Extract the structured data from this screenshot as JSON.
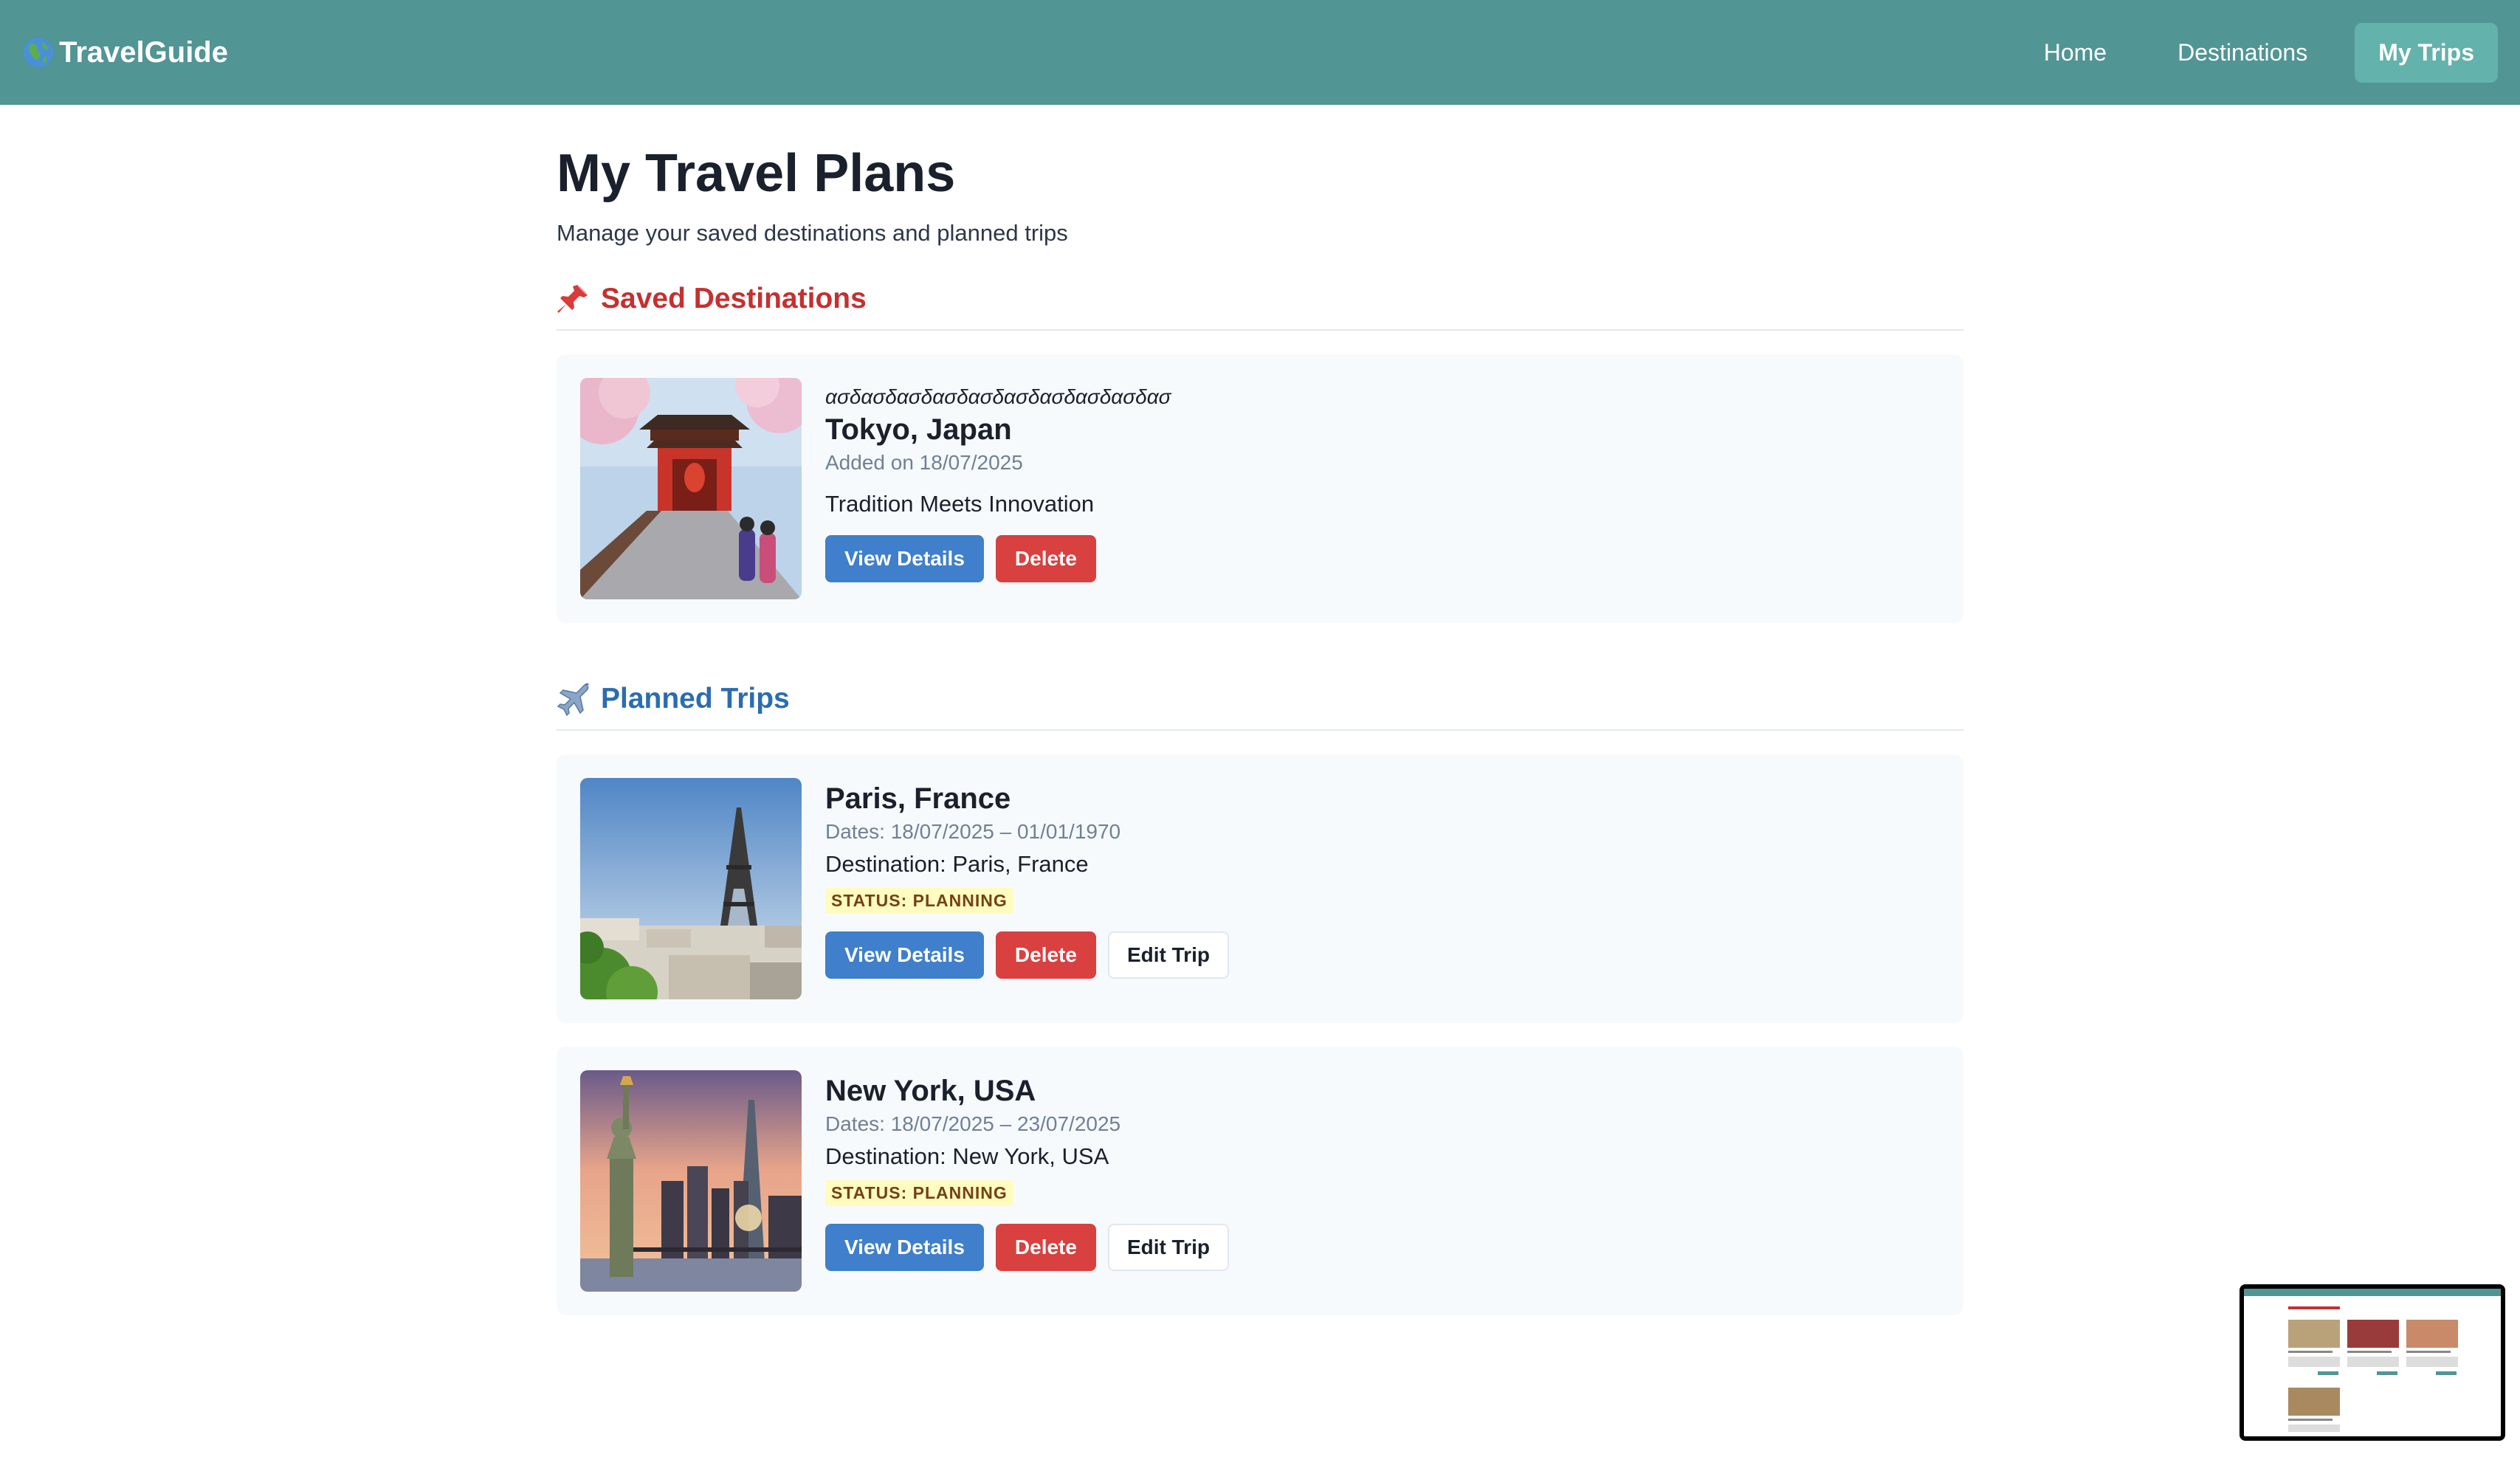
{
  "nav": {
    "brand": "TravelGuide",
    "links": [
      {
        "label": "Home"
      },
      {
        "label": "Destinations"
      },
      {
        "label": "My Trips"
      }
    ]
  },
  "page": {
    "title": "My Travel Plans",
    "subtitle": "Manage your saved destinations and planned trips"
  },
  "saved": {
    "heading": "Saved Destinations",
    "items": [
      {
        "note": "ασδασδασδασδασδασδασδασδασδασ",
        "name": "Tokyo, Japan",
        "added": "Added on 18/07/2025",
        "tagline": "Tradition Meets Innovation",
        "view_label": "View Details",
        "delete_label": "Delete"
      }
    ]
  },
  "planned": {
    "heading": "Planned Trips",
    "items": [
      {
        "name": "Paris, France",
        "dates": "Dates: 18/07/2025 – 01/01/1970",
        "destination": "Destination: Paris, France",
        "status": "STATUS: PLANNING",
        "view_label": "View Details",
        "delete_label": "Delete",
        "edit_label": "Edit Trip"
      },
      {
        "name": "New York, USA",
        "dates": "Dates: 18/07/2025 – 23/07/2025",
        "destination": "Destination: New York, USA",
        "status": "STATUS: PLANNING",
        "view_label": "View Details",
        "delete_label": "Delete",
        "edit_label": "Edit Trip"
      }
    ]
  },
  "colors": {
    "navbar": "#519594",
    "nav_active": "#63b2ab",
    "saved_heading": "#c53030",
    "planned_heading": "#2b6cb0",
    "primary_button": "#3f7fcb",
    "danger_button": "#d94040",
    "status_badge": "#fefcbf"
  },
  "icons": {
    "brand": "globe-icon",
    "saved": "pushpin-icon",
    "planned": "airplane-icon"
  }
}
